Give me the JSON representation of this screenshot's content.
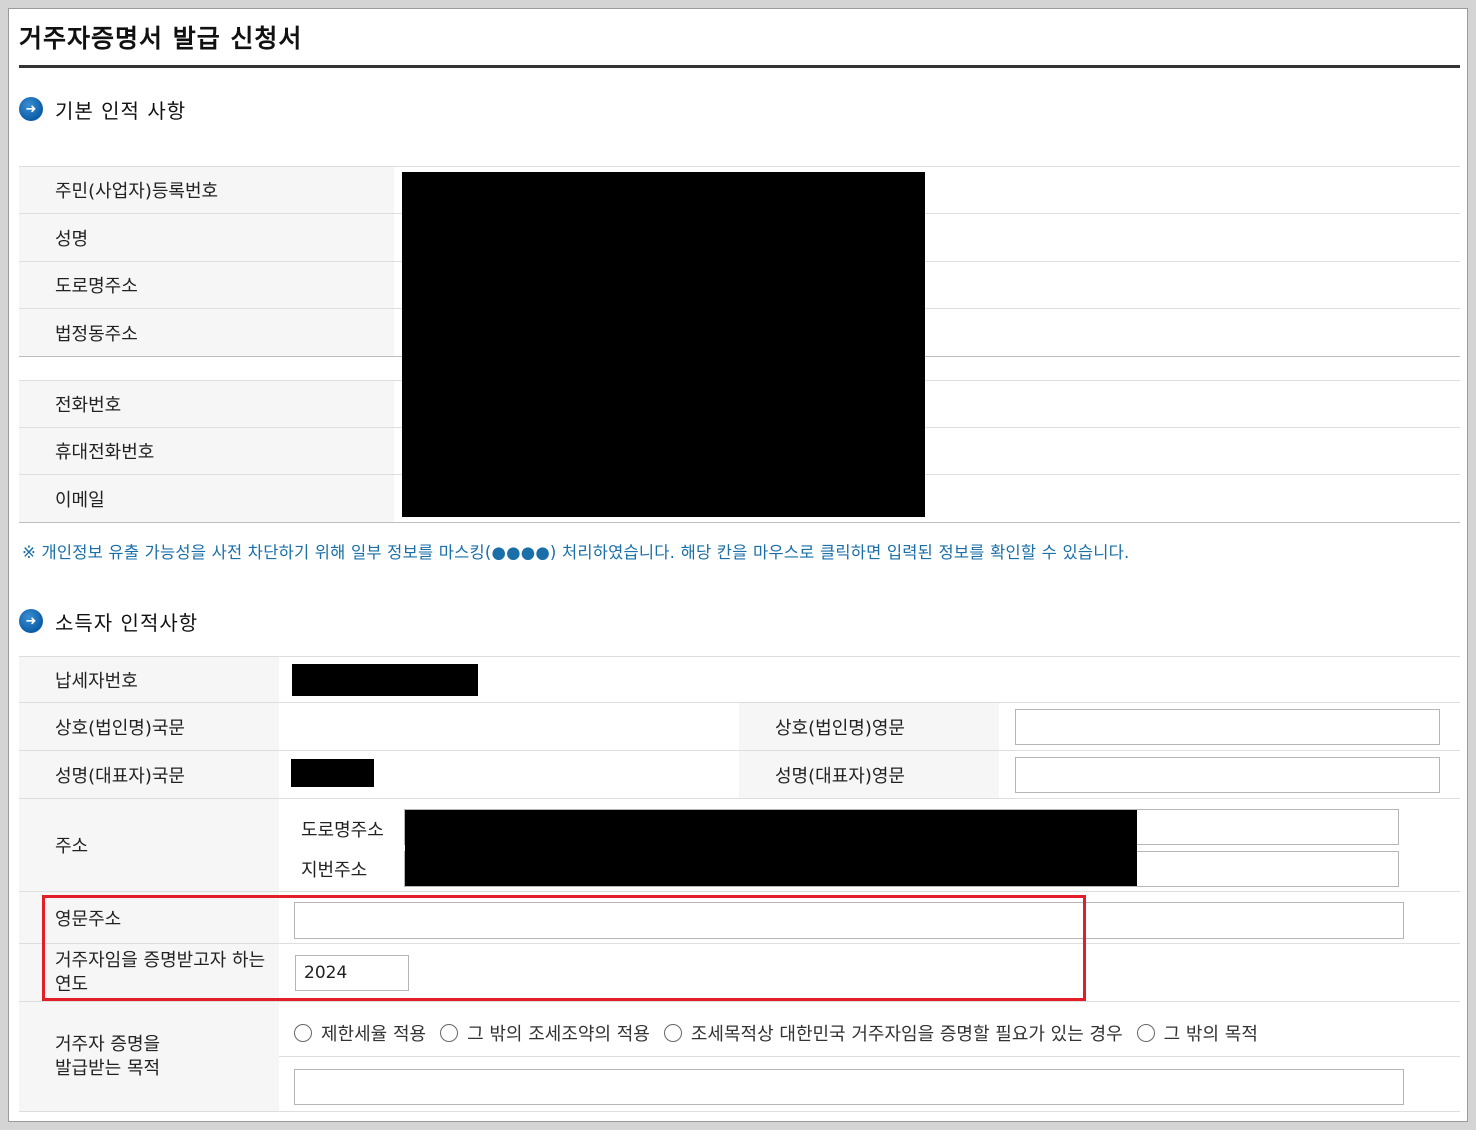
{
  "page": {
    "title": "거주자증명서 발급 신청서"
  },
  "basic_section": {
    "icon": "arrow-right-icon",
    "heading": "기본 인적 사항",
    "rows": [
      {
        "label": "주민(사업자)등록번호"
      },
      {
        "label": "성명"
      },
      {
        "label": "도로명주소"
      },
      {
        "label": "법정동주소"
      },
      {
        "label": "전화번호"
      },
      {
        "label": "휴대전화번호"
      },
      {
        "label": "이메일"
      }
    ],
    "notice": "※ 개인정보 유출 가능성을 사전 차단하기 위해 일부 정보를 마스킹(●●●●) 처리하였습니다. 해당 칸을 마우스로 클릭하면 입력된 정보를 확인할 수 있습니다."
  },
  "income_section": {
    "icon": "arrow-right-icon",
    "heading": "소득자 인적사항",
    "taxpayer_number_label": "납세자번호",
    "company_kr_label": "상호(법인명)국문",
    "company_en_label": "상호(법인명)영문",
    "name_kr_label": "성명(대표자)국문",
    "name_en_label": "성명(대표자)영문",
    "address_label": "주소",
    "road_address_label": "도로명주소",
    "lot_address_label": "지번주소",
    "english_address_label": "영문주소",
    "english_address_value": "",
    "year_label": "거주자임을 증명받고자 하는 연도",
    "year_value": "2024",
    "purpose_label": "거주자 증명을 발급받는 목적",
    "purpose_options": [
      "제한세율 적용",
      "그 밖의 조세조약의 적용",
      "조세목적상 대한민국 거주자임을 증명할 필요가 있는 경우",
      "그 밖의 목적"
    ]
  },
  "colors": {
    "highlight": "#e41e26",
    "accent_blue": "#0c5da8",
    "notice_text": "#1a6fa8"
  }
}
